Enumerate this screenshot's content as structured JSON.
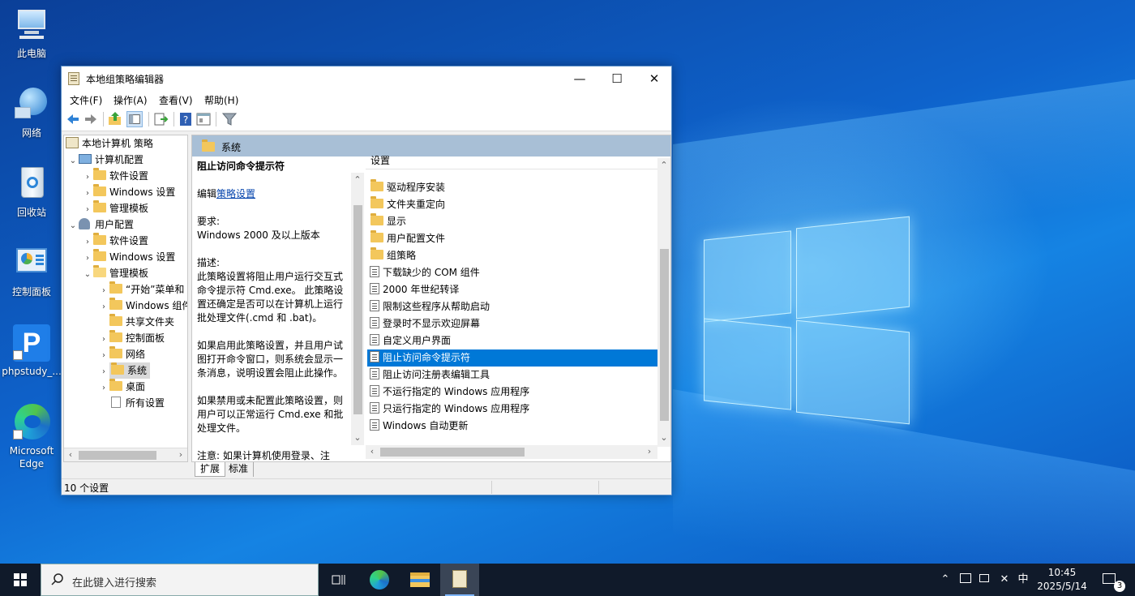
{
  "desktop": {
    "icons": [
      {
        "label": "此电脑"
      },
      {
        "label": "网络"
      },
      {
        "label": "回收站"
      },
      {
        "label": "控制面板"
      },
      {
        "label": "phpstudy_..."
      },
      {
        "label": "Microsoft Edge"
      }
    ]
  },
  "window": {
    "title": "本地组策略编辑器",
    "controls": {
      "minimize": "—",
      "maximize": "☐",
      "close": "✕"
    },
    "menu": [
      "文件(F)",
      "操作(A)",
      "查看(V)",
      "帮助(H)"
    ],
    "toolbar_icons": [
      "back-arrow-icon",
      "forward-arrow-icon",
      "up-folder-icon",
      "show-hide-tree-icon",
      "export-list-icon",
      "help-icon",
      "properties-icon",
      "filter-icon"
    ],
    "tree": {
      "root": "本地计算机 策略",
      "computer": "计算机配置",
      "computer_children": [
        "软件设置",
        "Windows 设置",
        "管理模板"
      ],
      "user": "用户配置",
      "user_children": [
        "软件设置",
        "Windows 设置",
        "管理模板"
      ],
      "admin_children": [
        "“开始”菜单和",
        "Windows 组件",
        "共享文件夹",
        "控制面板",
        "网络",
        "系统",
        "桌面",
        "所有设置"
      ],
      "selected": "系统"
    },
    "right_header": "系统",
    "description": {
      "title": "阻止访问命令提示符",
      "edit_prefix": "编辑",
      "edit_link": "策略设置",
      "requirements_label": "要求:",
      "requirements": "Windows 2000 及以上版本",
      "description_label": "描述:",
      "desc_p1": "此策略设置将阻止用户运行交互式命令提示符 Cmd.exe。 此策略设置还确定是否可以在计算机上运行批处理文件(.cmd 和 .bat)。",
      "desc_p2": "如果启用此策略设置，并且用户试图打开命令窗口，则系统会显示一条消息，说明设置会阻止此操作。",
      "desc_p3": "如果禁用或未配置此策略设置，则用户可以正常运行 Cmd.exe 和批处理文件。",
      "desc_p4": "注意: 如果计算机使用登录、注"
    },
    "list": {
      "column_header": "设置",
      "folders": [
        "驱动程序安装",
        "文件夹重定向",
        "显示",
        "用户配置文件",
        "组策略"
      ],
      "policies": [
        "下载缺少的 COM 组件",
        "2000 年世纪转译",
        "限制这些程序从帮助启动",
        "登录时不显示欢迎屏幕",
        "自定义用户界面",
        "阻止访问命令提示符",
        "阻止访问注册表编辑工具",
        "不运行指定的 Windows 应用程序",
        "只运行指定的 Windows 应用程序",
        "Windows 自动更新"
      ],
      "selected": "阻止访问命令提示符"
    },
    "tabs": [
      "扩展",
      "标准"
    ],
    "status": "10 个设置"
  },
  "taskbar": {
    "search_placeholder": "在此键入进行搜索",
    "apps": [
      "task-view-icon",
      "edge-icon",
      "file-explorer-icon",
      "group-policy-icon"
    ],
    "tray": {
      "ime": "中",
      "time": "10:45",
      "date": "2025/5/14",
      "notification_count": "3"
    }
  }
}
